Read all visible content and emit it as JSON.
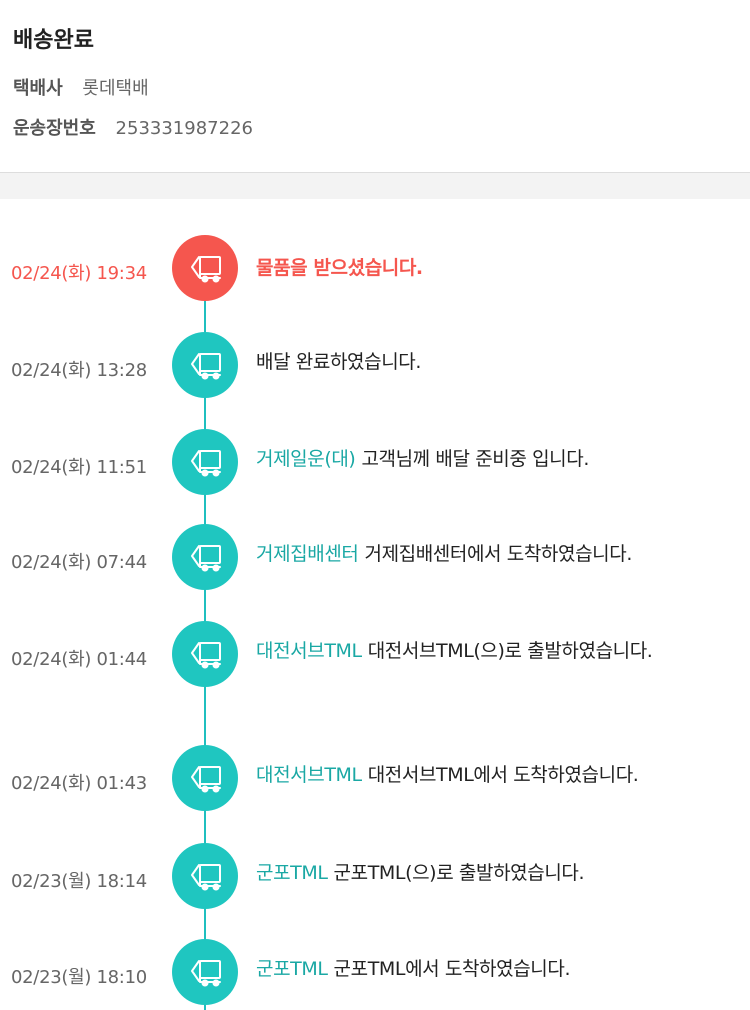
{
  "header": {
    "status_title": "배송완료",
    "carrier_label": "택배사",
    "carrier_value": "롯데택배",
    "tracking_label": "운송장번호",
    "tracking_value": "253331987226"
  },
  "colors": {
    "accent_teal": "#1fc6c0",
    "location_teal": "#1aa8a4",
    "active_red": "#f5564e"
  },
  "events": [
    {
      "time": "02/24(화) 19:34",
      "location": "",
      "message": "물품을 받으셨습니다.",
      "active": true,
      "icon": "delivery-truck-icon"
    },
    {
      "time": "02/24(화) 13:28",
      "location": "",
      "message": "배달 완료하였습니다.",
      "active": false,
      "icon": "delivery-truck-icon"
    },
    {
      "time": "02/24(화) 11:51",
      "location": "거제일운(대)",
      "message": "고객님께 배달 준비중 입니다.",
      "active": false,
      "icon": "delivery-truck-icon"
    },
    {
      "time": "02/24(화) 07:44",
      "location": "거제집배센터",
      "message": "거제집배센터에서 도착하였습니다.",
      "active": false,
      "icon": "delivery-truck-icon"
    },
    {
      "time": "02/24(화) 01:44",
      "location": "대전서브TML",
      "message": "대전서브TML(으)로 출발하였습니다.",
      "active": false,
      "icon": "delivery-truck-icon"
    },
    {
      "time": "02/24(화) 01:43",
      "location": "대전서브TML",
      "message": "대전서브TML에서 도착하였습니다.",
      "active": false,
      "icon": "delivery-truck-icon"
    },
    {
      "time": "02/23(월) 18:14",
      "location": "군포TML",
      "message": "군포TML(으)로 출발하였습니다.",
      "active": false,
      "icon": "delivery-truck-icon"
    },
    {
      "time": "02/23(월) 18:10",
      "location": "군포TML",
      "message": "군포TML에서 도착하였습니다.",
      "active": false,
      "icon": "delivery-truck-icon"
    }
  ]
}
